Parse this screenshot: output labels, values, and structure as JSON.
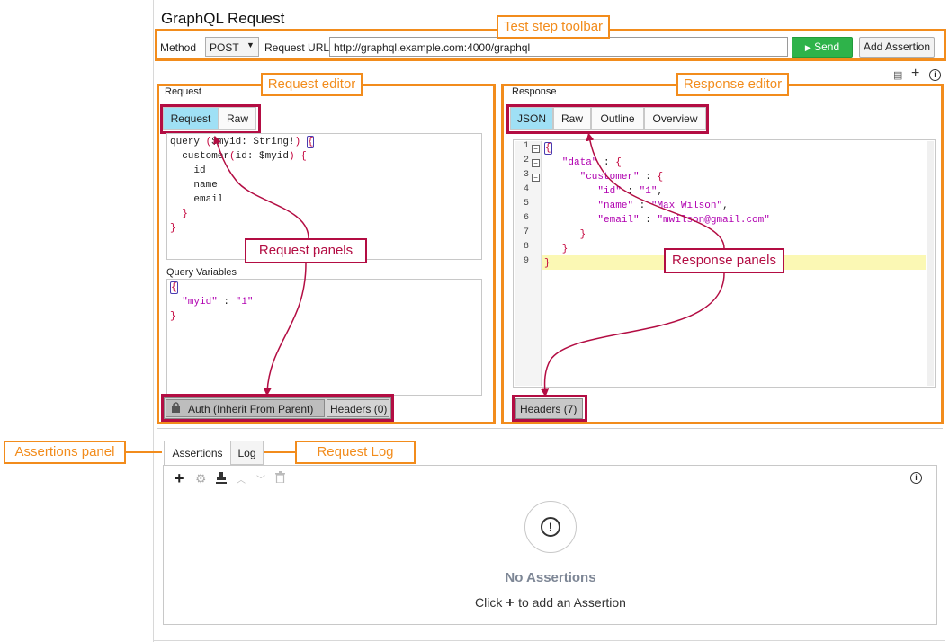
{
  "title": "GraphQL Request",
  "toolbar": {
    "method_label": "Method",
    "method_value": "POST",
    "url_label": "Request URL:",
    "url_value": "http://graphql.example.com:4000/graphql",
    "send_label": "Send",
    "add_assertion_label": "Add Assertion"
  },
  "request": {
    "section_label": "Request",
    "tabs": [
      "Request",
      "Raw"
    ],
    "query_lines": [
      "query ($myid: String!) {",
      "  customer(id: $myid) {",
      "    id",
      "    name",
      "    email",
      "  }",
      "}"
    ],
    "variables_label": "Query Variables",
    "variables_lines": [
      "{",
      "  \"myid\" : \"1\"",
      "}"
    ],
    "bottom_tabs": [
      "Auth (Inherit From Parent)",
      "Headers (0)"
    ]
  },
  "response": {
    "section_label": "Response",
    "tabs": [
      "JSON",
      "Raw",
      "Outline",
      "Overview"
    ],
    "line_numbers": [
      "1",
      "2",
      "3",
      "4",
      "5",
      "6",
      "7",
      "8",
      "9"
    ],
    "lines": [
      "{",
      "   \"data\" : {",
      "      \"customer\" : {",
      "         \"id\" : \"1\",",
      "         \"name\" : \"Max Wilson\",",
      "         \"email\" : \"mwilson@gmail.com\"",
      "      }",
      "   }",
      "}"
    ],
    "bottom_tabs": [
      "Headers (7)"
    ]
  },
  "assertions": {
    "tabs": [
      "Assertions",
      "Log"
    ],
    "empty_title": "No Assertions",
    "hint_prefix": "Click",
    "hint_suffix": "to add an Assertion"
  },
  "callouts": {
    "test_step_toolbar": "Test step toolbar",
    "request_editor": "Request editor",
    "response_editor": "Response editor",
    "request_panels": "Request panels",
    "response_panels": "Response panels",
    "assertions_panel": "Assertions panel",
    "request_log": "Request Log"
  },
  "colors": {
    "callout_orange": "#f28c1c",
    "callout_crimson": "#b30d43",
    "active_tab": "#9fe0f5",
    "send_green": "#2eb34a",
    "highlight_line": "#fbf8b4"
  }
}
